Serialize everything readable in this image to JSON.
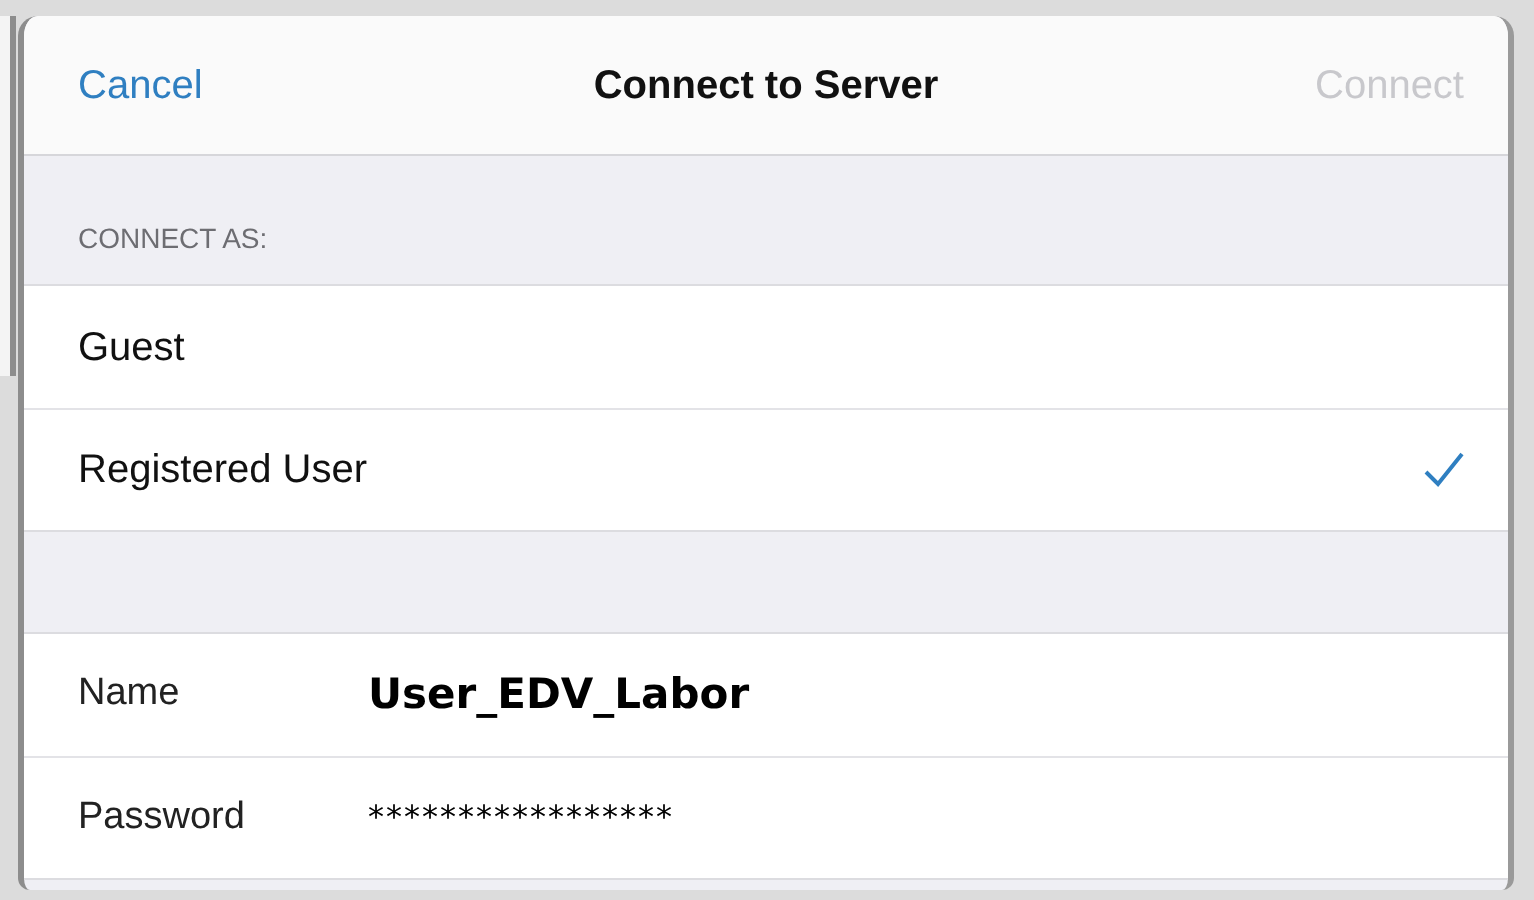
{
  "navigation_bar": {
    "cancel": "Cancel",
    "title": "Connect to Server",
    "connect": {
      "label": "Connect",
      "disabled": true
    }
  },
  "connect_as": {
    "header": "CONNECT AS:",
    "options": [
      {
        "label": "Guest",
        "selected": false
      },
      {
        "label": "Registered User",
        "selected": true
      }
    ]
  },
  "fields": [
    {
      "label": "Name",
      "value": "User_EDV_Labor",
      "kind": "text"
    },
    {
      "label": "Password",
      "value": "*****************",
      "kind": "password"
    }
  ]
}
